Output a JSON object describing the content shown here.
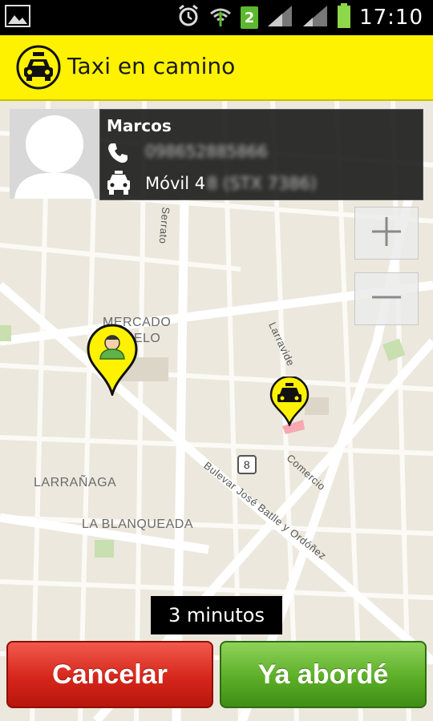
{
  "status_bar": {
    "time": "17:10",
    "notification_count": "2",
    "icons": [
      "image-icon",
      "alarm-icon",
      "wifi-icon",
      "signal-icon",
      "battery-icon"
    ]
  },
  "header": {
    "title": "Taxi en camino",
    "icon": "taxi-logo-icon",
    "background_color": "#fff200"
  },
  "driver": {
    "name": "Marcos",
    "phone": "098652885866",
    "vehicle_label": "Móvil 4",
    "vehicle_detail": "8 (STX 7386)"
  },
  "map": {
    "labels": {
      "mercado": "MERCADO",
      "modelo": "MODELO",
      "larranaga": "LARRAÑAGA",
      "blanqueada": "LA BLANQUEADA",
      "serrato": "Serrato",
      "larravide": "Larravide",
      "comercio": "Comercio",
      "batlle": "Bulevar José Batlle y Ordóñez",
      "route": "8"
    },
    "zoom_in": "+",
    "zoom_out": "−"
  },
  "eta": "3 minutos",
  "buttons": {
    "cancel": "Cancelar",
    "board": "Ya abordé"
  },
  "colors": {
    "cancel": "#d6261b",
    "board": "#5cae27",
    "marker": "#fff200"
  }
}
